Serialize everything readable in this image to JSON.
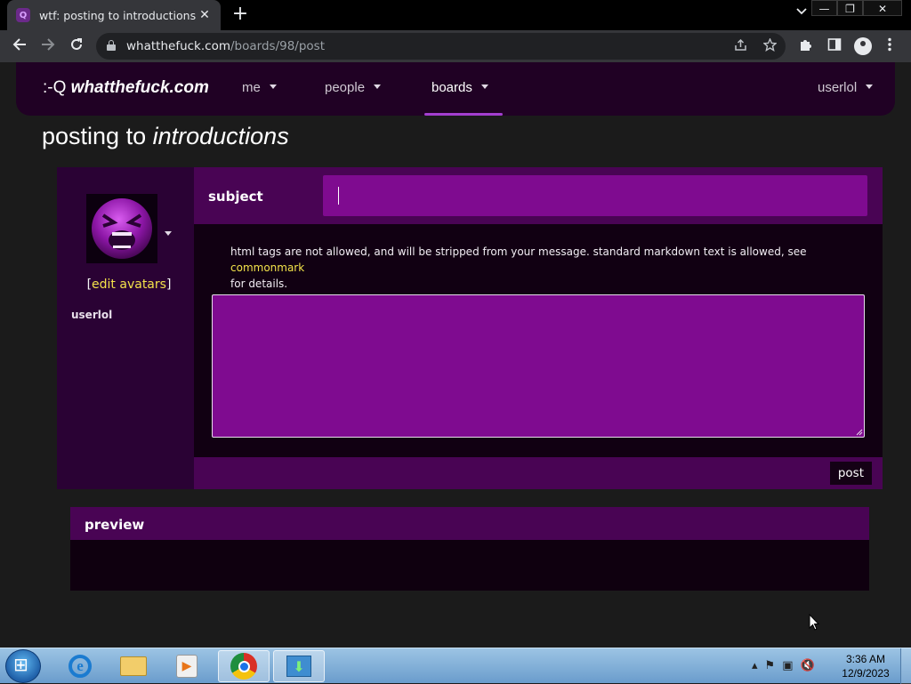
{
  "browser": {
    "tab_title": "wtf: posting to introductions",
    "tab_close": "✕",
    "new_tab": "+",
    "url_host": "whatthefuck.com",
    "url_path": "/boards/98/post",
    "window_buttons": {
      "minimize": "—",
      "restore": "❐",
      "close": "✕"
    }
  },
  "navbar": {
    "brand_face": ":-Q",
    "brand_site": "whatthefuck.com",
    "items": [
      {
        "label": "me"
      },
      {
        "label": "people"
      },
      {
        "label": "boards"
      }
    ],
    "user": "userlol"
  },
  "page": {
    "title_prefix": "posting to",
    "title_board": "introductions"
  },
  "author": {
    "edit_open": "[",
    "edit_link": "edit avatars",
    "edit_close": "]",
    "name": "userlol"
  },
  "form": {
    "subject_label": "subject",
    "subject_value": "",
    "info_text": "html tags are not allowed, and will be stripped from your message. standard markdown text is allowed, see",
    "info_link": "commonmark",
    "info_suffix": "for details.",
    "body_value": "",
    "post_button": "post"
  },
  "preview": {
    "title": "preview"
  },
  "taskbar": {
    "clock_time": "3:36 AM",
    "clock_date": "12/9/2023"
  },
  "colors": {
    "accent": "#490454",
    "input": "#7f0b90",
    "link": "#f3e24a"
  }
}
